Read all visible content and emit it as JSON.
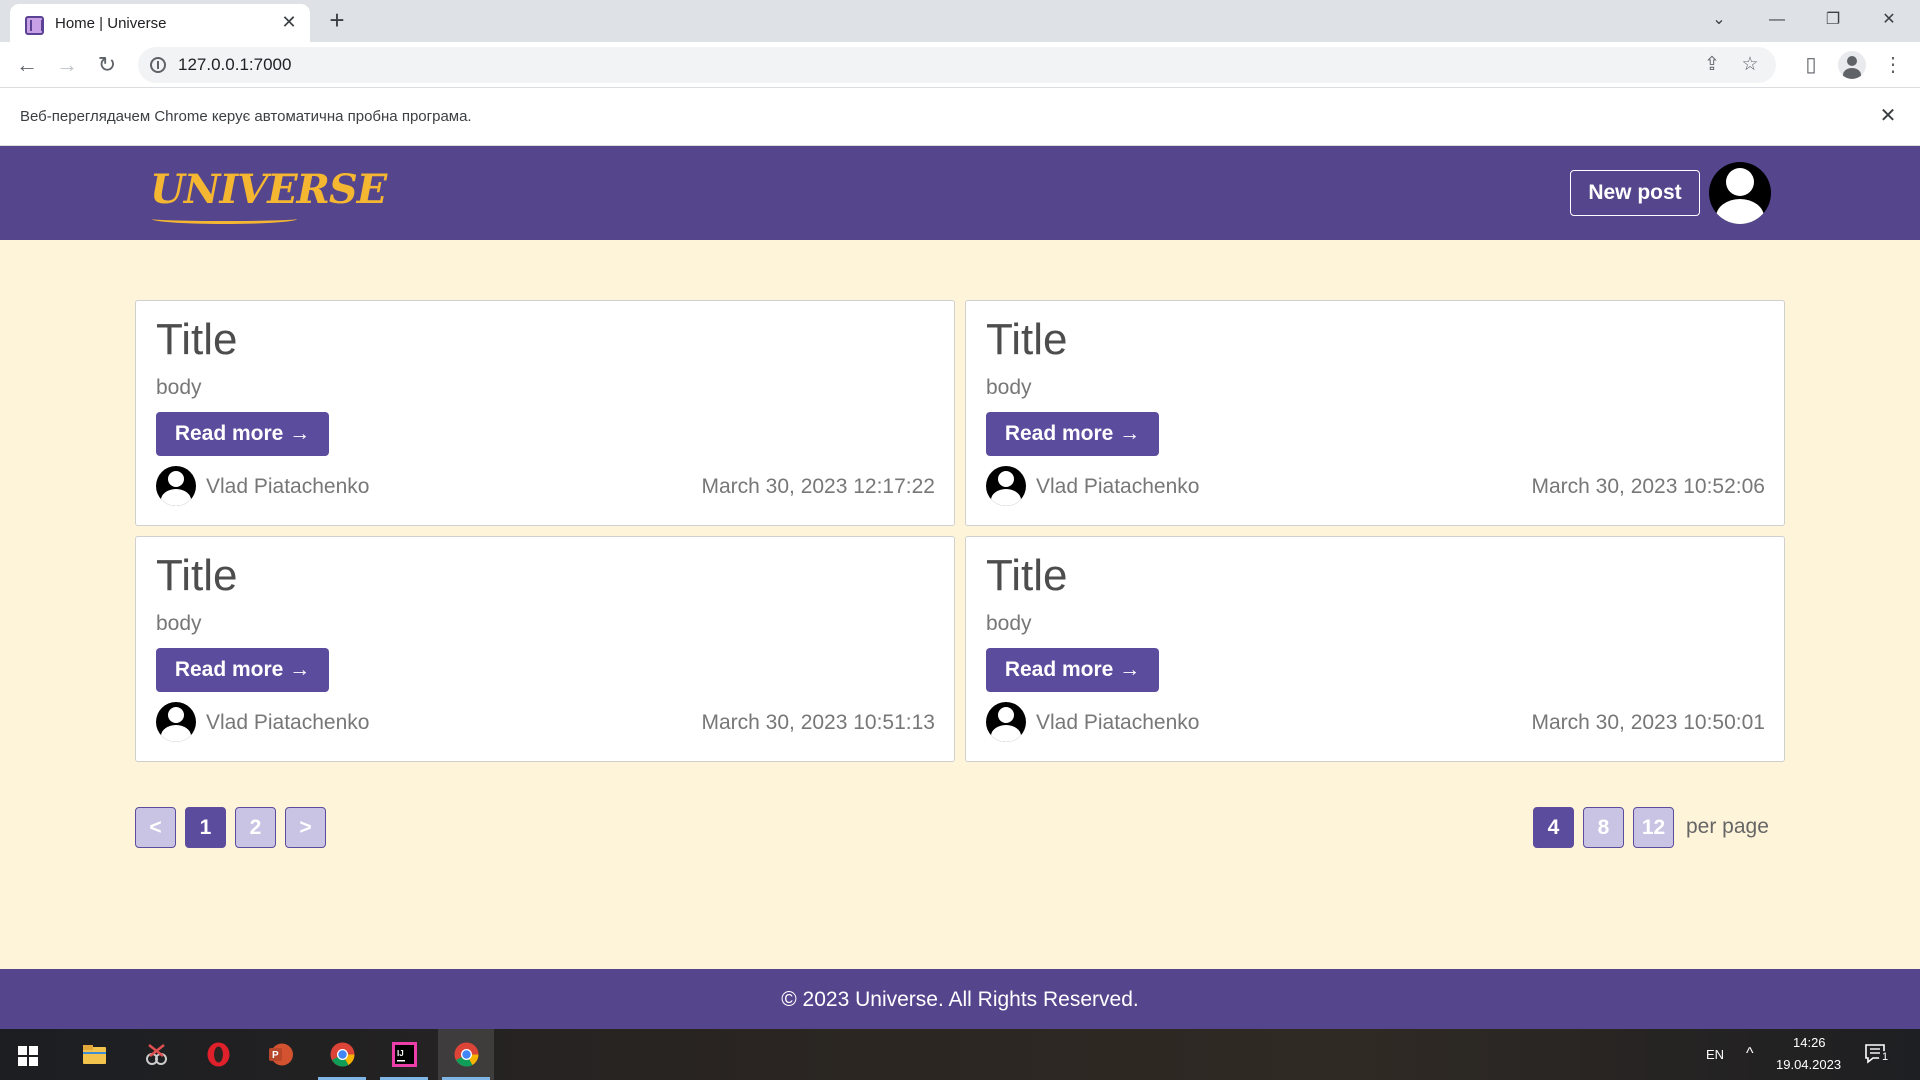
{
  "browser": {
    "tab_title": "Home | Universe",
    "tab_close": "✕",
    "new_tab": "+",
    "url": "127.0.0.1:7000",
    "infobar_text": "Веб-переглядачем Chrome керує автоматична пробна програма.",
    "infobar_close": "✕",
    "controls": {
      "tab_search": "⌄",
      "minimize": "—",
      "restore": "❐",
      "close": "✕"
    },
    "nav": {
      "back": "←",
      "forward": "→",
      "reload": "↻"
    },
    "icons": {
      "share": "⇪",
      "bookmark": "☆",
      "side_panel": "▯",
      "menu": "⋮"
    }
  },
  "site": {
    "logo_text": "UNIVERSE",
    "new_post_label": "New post",
    "colors": {
      "header": "#54458d",
      "accent": "#5c4c9e",
      "logo": "#f5b731",
      "background": "#fef4d9"
    }
  },
  "posts": [
    {
      "title": "Title",
      "body": "body",
      "read_more": "Read more →",
      "author": "Vlad Piatachenko",
      "date": "March 30, 2023 12:17:22"
    },
    {
      "title": "Title",
      "body": "body",
      "read_more": "Read more →",
      "author": "Vlad Piatachenko",
      "date": "March 30, 2023 10:52:06"
    },
    {
      "title": "Title",
      "body": "body",
      "read_more": "Read more →",
      "author": "Vlad Piatachenko",
      "date": "March 30, 2023 10:51:13"
    },
    {
      "title": "Title",
      "body": "body",
      "read_more": "Read more →",
      "author": "Vlad Piatachenko",
      "date": "March 30, 2023 10:50:01"
    }
  ],
  "pagination": {
    "prev": "<",
    "pages": [
      "1",
      "2"
    ],
    "current_page": "1",
    "next": ">",
    "per_page_options": [
      "4",
      "8",
      "12"
    ],
    "per_page_selected": "4",
    "per_page_label": "per page"
  },
  "footer": {
    "text": "© 2023 Universe. All Rights Reserved."
  },
  "taskbar": {
    "language": "EN",
    "tray_chevron": "^",
    "time": "14:26",
    "date": "19.04.2023",
    "notifications": "1"
  }
}
